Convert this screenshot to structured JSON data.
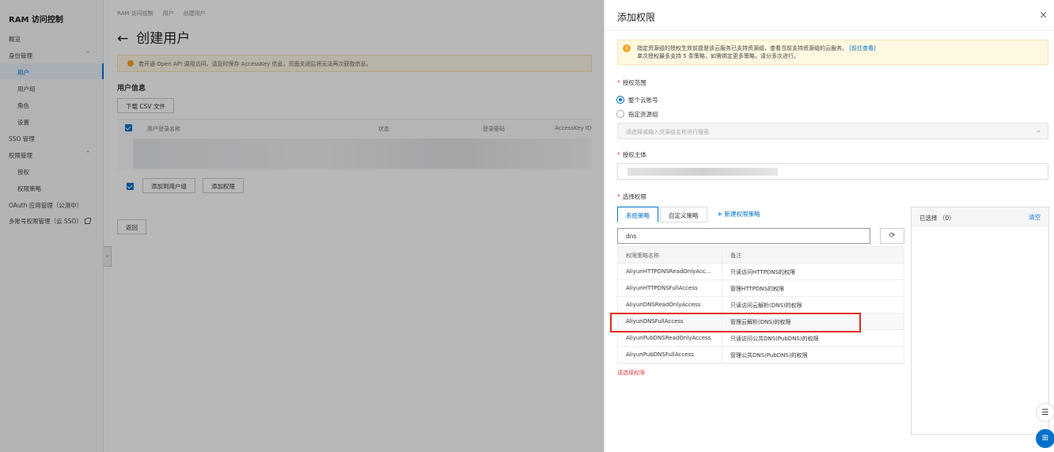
{
  "sidebar": {
    "title": "RAM 访问控制",
    "items": [
      {
        "label": "概览"
      },
      {
        "label": "身份管理",
        "caret": "^"
      },
      {
        "label": "用户"
      },
      {
        "label": "用户组"
      },
      {
        "label": "角色"
      },
      {
        "label": "设置"
      },
      {
        "label": "SSO 管理"
      },
      {
        "label": "权限管理",
        "caret": "^"
      },
      {
        "label": "授权"
      },
      {
        "label": "权限策略"
      },
      {
        "label": "OAuth 应用管理（公测中）"
      },
      {
        "label": "多账号权限管理（云 SSO）"
      }
    ]
  },
  "main": {
    "breadcrumb": [
      "RAM 访问控制",
      "用户",
      "创建用户"
    ],
    "title": "创建用户",
    "notice": "若开通 Open API 调用访问，请及时保存 AccessKey 信息，页面关闭后将无法再次获取信息。",
    "section_title": "用户信息",
    "download_btn": "下载 CSV 文件",
    "table_headers": [
      "用户登录名称",
      "状态",
      "登录密码",
      "AccessKey ID"
    ],
    "add_to_group_btn": "添加到用户组",
    "add_perm_btn": "添加权限",
    "back_btn": "返回"
  },
  "drawer": {
    "title": "添加权限",
    "close": "×",
    "alert_line1": "指定资源组的授权生效前提是该云服务已支持资源组，查看当前支持资源组的云服务。",
    "alert_link": "[前往查看]",
    "alert_line2": "单次授权最多支持 5 条策略，如需绑定更多策略，请分多次进行。",
    "scope_label": "授权范围",
    "scope_options": [
      "整个云账号",
      "指定资源组"
    ],
    "resource_placeholder": "请选择或输入资源组名称进行搜索",
    "principal_label": "授权主体",
    "select_perm_label": "选择权限",
    "tabs": [
      "系统策略",
      "自定义策略"
    ],
    "new_policy_link": "新建权限策略",
    "search_value": "dns",
    "policy_table": {
      "headers": [
        "权限策略名称",
        "备注"
      ],
      "rows": [
        [
          "AliyunHTTPDNSReadOnlyAcc...",
          "只读访问HTTPDNS的权限"
        ],
        [
          "AliyunHTTPDNSFullAccess",
          "管理HTTPDNS的权限"
        ],
        [
          "AliyunDNSReadOnlyAccess",
          "只读访问云解析(DNS)的权限"
        ],
        [
          "AliyunDNSFullAccess",
          "管理云解析(DNS)的权限"
        ],
        [
          "AliyunPubDNSReadOnlyAccess",
          "只读访问公共DNS(PubDNS)的权限"
        ],
        [
          "AliyunPubDNSFullAccess",
          "管理公共DNS(PubDNS)的权限"
        ]
      ]
    },
    "error_text": "请选择权限",
    "selected_label": "已选择 （0）",
    "clear_label": "清空"
  },
  "colors": {
    "accent": "#0070cc",
    "highlight_border": "#e02b20",
    "warning": "#f5a623"
  }
}
